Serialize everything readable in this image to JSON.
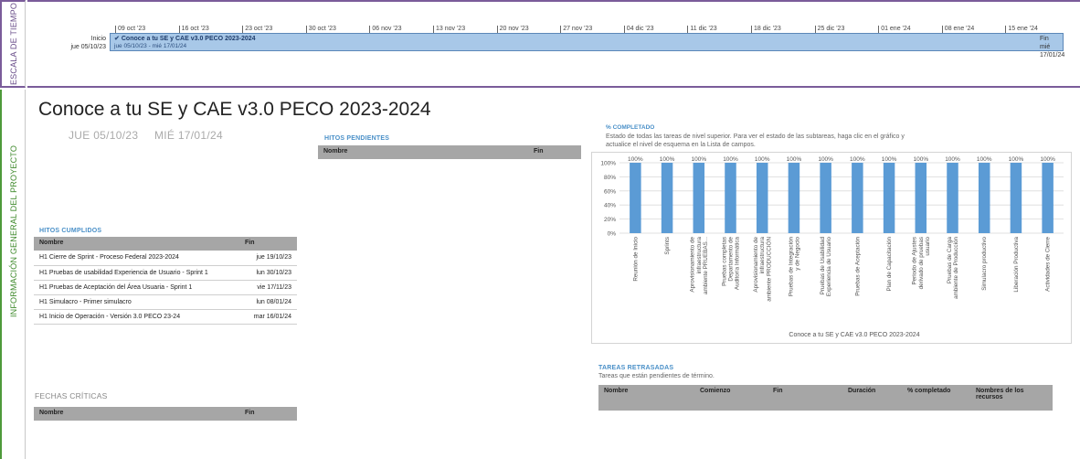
{
  "sidebar": {
    "timeline_label": "ESCALA DE TIEMPO",
    "project_label": "INFORMACIÓN GENERAL DEL PROYECTO"
  },
  "timeline": {
    "start_label": "Inicio",
    "start_date": "jue 05/10/23",
    "end_label": "Fin",
    "end_date": "mié 17/01/24",
    "ticks": [
      "09 oct '23",
      "16 oct '23",
      "23 oct '23",
      "30 oct '23",
      "06 nov '23",
      "13 nov '23",
      "20 nov '23",
      "27 nov '23",
      "04 dic '23",
      "11 dic '23",
      "18 dic '23",
      "25 dic '23",
      "01 ene '24",
      "08 ene '24",
      "15 ene '24"
    ],
    "bar_title": "Conoce a tu SE y CAE v3.0 PECO 2023-2024",
    "bar_dates": "jue 05/10/23 - mié 17/01/24"
  },
  "report": {
    "title": "Conoce a tu SE y CAE v3.0 PECO 2023-2024",
    "start": "JUE 05/10/23",
    "end": "MIÉ 17/01/24"
  },
  "hitos_cumplidos": {
    "title": "HITOS CUMPLIDOS",
    "headers": [
      "Nombre",
      "Fin"
    ],
    "rows": [
      [
        "H1 Cierre de Sprint - Proceso Federal 2023-2024",
        "jue 19/10/23"
      ],
      [
        "H1 Pruebas de usabilidad Experiencia de Usuario - Sprint 1",
        "lun 30/10/23"
      ],
      [
        "H1 Pruebas de Aceptación del Área Usuaria - Sprint 1",
        "vie 17/11/23"
      ],
      [
        "H1 Simulacro - Primer simulacro",
        "lun 08/01/24"
      ],
      [
        "H1 Inicio de Operación - Versión 3.0 PECO 23-24",
        "mar 16/01/24"
      ]
    ]
  },
  "fechas_criticas": {
    "title": "FECHAS CRÍTICAS",
    "headers": [
      "Nombre",
      "Fin"
    ]
  },
  "hitos_pendientes": {
    "title": "HITOS PENDIENTES",
    "headers": [
      "Nombre",
      "Fin"
    ]
  },
  "chart_section": {
    "title": "% COMPLETADO",
    "description": "Estado de todas las tareas de nivel superior. Para ver el estado de las subtareas, haga clic en el gráfico y actualice el nivel de esquema en la Lista de campos."
  },
  "tareas_retrasadas": {
    "title": "TAREAS RETRASADAS",
    "description": "Tareas que están pendientes de término.",
    "headers": [
      "Nombre",
      "Comienzo",
      "Fin",
      "Duración",
      "% completado",
      "Nombres de los recursos"
    ]
  },
  "colors": {
    "bar": "#5b9bd5",
    "timeline_bar": "#a8c8e8",
    "section_title": "#4a90c8"
  },
  "chart_data": {
    "type": "bar",
    "title": "",
    "xlabel": "Conoce a tu SE y CAE v3.0 PECO 2023-2024",
    "ylabel": "",
    "ylim": [
      0,
      100
    ],
    "yticks": [
      "0%",
      "20%",
      "40%",
      "60%",
      "80%",
      "100%"
    ],
    "categories": [
      "Reunión de Inicio",
      "Sprints",
      "Aprovisionamiento de infraestructura ambiente PRUEBAS...",
      "Pruebas completas Departamento de Auditoría Informática",
      "Aprovisionamiento de infraestructura ambiente PRODUCCIÓN",
      "Pruebas de Integración y de Negocio",
      "Pruebas de Usabilidad Experiencia de Usuario",
      "Pruebas de Aceptación",
      "Plan de Capacitación",
      "Periodo de Ajustes derivado de pruebas usuario",
      "Pruebas de Carga ambiente de Producción",
      "Simulacro productivo",
      "Liberación Productiva",
      "Actividades de Cierre"
    ],
    "values": [
      100,
      100,
      100,
      100,
      100,
      100,
      100,
      100,
      100,
      100,
      100,
      100,
      100,
      100
    ],
    "data_labels": [
      "100%",
      "100%",
      "100%",
      "100%",
      "100%",
      "100%",
      "100%",
      "100%",
      "100%",
      "100%",
      "100%",
      "100%",
      "100%",
      "100%"
    ],
    "grid": true,
    "legend": "none"
  }
}
